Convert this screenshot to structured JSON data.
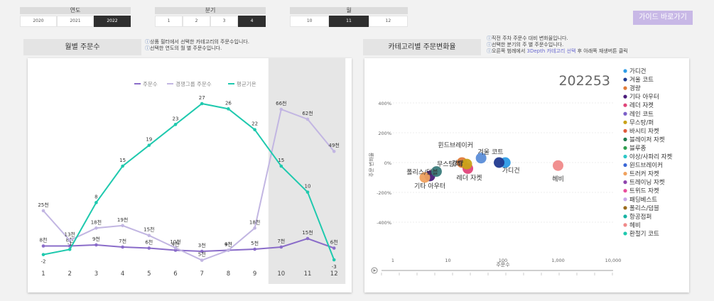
{
  "slicers": {
    "year": {
      "label": "연도",
      "options": [
        "2020",
        "2021",
        "2022"
      ],
      "selected": "2022"
    },
    "quarter": {
      "label": "분기",
      "options": [
        "1",
        "2",
        "3",
        "4"
      ],
      "selected": "4"
    },
    "month": {
      "label": "월",
      "options": [
        "10",
        "11",
        "12"
      ],
      "selected": "11"
    }
  },
  "guide_button": "가이드 바로가기",
  "left_panel": {
    "title": "월별 주문수",
    "notes": [
      "상품 필터에서 선택한 카테고리의 주문수입니다.",
      "선택한 연도의 월 별 주문수입니다."
    ]
  },
  "right_panel": {
    "title": "카테고리별 주문변화율",
    "notes": [
      "직전 주차 주문수 대비 변화율입니다.",
      "선택한 분기의 주 별 주문수입니다.",
      "오른쪽 범례에서 ",
      "3Depth 카테고리 선택",
      " 후 아래쪽 재생버튼 클릭"
    ]
  },
  "chart_data": [
    {
      "type": "line",
      "x": [
        1,
        2,
        3,
        4,
        5,
        6,
        7,
        8,
        9,
        10,
        11,
        12
      ],
      "series": [
        {
          "name": "주문수",
          "color": "#8a6cc9",
          "values": [
            8,
            8,
            9,
            7,
            6,
            4,
            3,
            4,
            5,
            7,
            15,
            6
          ],
          "labels": [
            "8천",
            "8천",
            "9천",
            "7천",
            "6천",
            "4천",
            "3천",
            "4천",
            "5천",
            "7천",
            "15천",
            "6천"
          ]
        },
        {
          "name": "경쟁그룹 주문수",
          "color": "#c2b6e2",
          "values": [
            25,
            13,
            18,
            19,
            15,
            10,
            5,
            9,
            18,
            66,
            62,
            49
          ],
          "labels": [
            "25천",
            "13천",
            "18천",
            "19천",
            "15천",
            "10천",
            "5천",
            "9천",
            "18천",
            "66천",
            "62천",
            "49천"
          ]
        },
        {
          "name": "평균기온",
          "color": "#1fc9ae",
          "values": [
            -2,
            -1,
            8,
            15,
            19,
            23,
            27,
            26,
            22,
            15,
            10,
            -3
          ],
          "labels": [
            "-2",
            "-1",
            "8",
            "15",
            "19",
            "23",
            "27",
            "26",
            "22",
            "15",
            "10",
            "-3"
          ]
        }
      ],
      "highlight_range": [
        10,
        12
      ],
      "legend": "top"
    },
    {
      "type": "scatter",
      "title": "202253",
      "xlabel": "주문수",
      "ylabel": "주문 변화율",
      "x_scale": "log",
      "xlim": [
        1,
        10000
      ],
      "ylim": [
        -500,
        500
      ],
      "x_ticks": [
        "1",
        "10",
        "100",
        "1,000",
        "10,000"
      ],
      "y_ticks": [
        "400%",
        "200%",
        "0%",
        "-200%",
        "-400%"
      ],
      "points": [
        {
          "label": "가디건",
          "x": 110,
          "y": 0,
          "color": "#2d9be6"
        },
        {
          "label": "겨울 코트",
          "x": 85,
          "y": 0,
          "color": "#213a8f"
        },
        {
          "label": "경량",
          "x": 18,
          "y": 0,
          "color": "#e07b39"
        },
        {
          "label": "기타 아우터",
          "x": 4.7,
          "y": -90,
          "color": "#4b1c7a"
        },
        {
          "label": "레더 자켓",
          "x": 23,
          "y": -40,
          "color": "#e0457a"
        },
        {
          "label": "무스탕/퍼",
          "x": 22,
          "y": -10,
          "color": "#c9a218"
        },
        {
          "label": "윈드브레이커",
          "x": 40,
          "y": 30,
          "color": "#5b8dd8"
        },
        {
          "label": "폴리스/덤블",
          "x": 6.2,
          "y": -60,
          "color": "#3a7b7b"
        },
        {
          "label": "헤비",
          "x": 1000,
          "y": -20,
          "color": "#f08a8a"
        },
        {
          "label": "",
          "x": 3.8,
          "y": -100,
          "color": "#f0a15e"
        }
      ],
      "legend": {
        "placement": "right",
        "items": [
          {
            "name": "가디건",
            "color": "#2d9be6"
          },
          {
            "name": "겨울 코트",
            "color": "#213a8f"
          },
          {
            "name": "경량",
            "color": "#e07b39"
          },
          {
            "name": "기타 아우터",
            "color": "#4b1c7a"
          },
          {
            "name": "레더 자켓",
            "color": "#e0457a"
          },
          {
            "name": "레인 코트",
            "color": "#7b5fc8"
          },
          {
            "name": "무스탕/퍼",
            "color": "#c9a218"
          },
          {
            "name": "바시티 자켓",
            "color": "#e05a3c"
          },
          {
            "name": "블레이저 자켓",
            "color": "#1f7a4d"
          },
          {
            "name": "블루종",
            "color": "#2e9e4f"
          },
          {
            "name": "야상/사파리 자켓",
            "color": "#2dc7c7"
          },
          {
            "name": "윈드브레이커",
            "color": "#3a67d6"
          },
          {
            "name": "트러커 자켓",
            "color": "#f0a15e"
          },
          {
            "name": "트레이닝 자켓",
            "color": "#8e44ad"
          },
          {
            "name": "트위드 자켓",
            "color": "#e94d9c"
          },
          {
            "name": "패딩베스트",
            "color": "#c8a8e8"
          },
          {
            "name": "폴리스/덤블",
            "color": "#9a6b1c"
          },
          {
            "name": "항공점퍼",
            "color": "#17b3a3"
          },
          {
            "name": "헤비",
            "color": "#f08a8a"
          },
          {
            "name": "환절기 코트",
            "color": "#1fc9ae"
          }
        ]
      }
    }
  ]
}
